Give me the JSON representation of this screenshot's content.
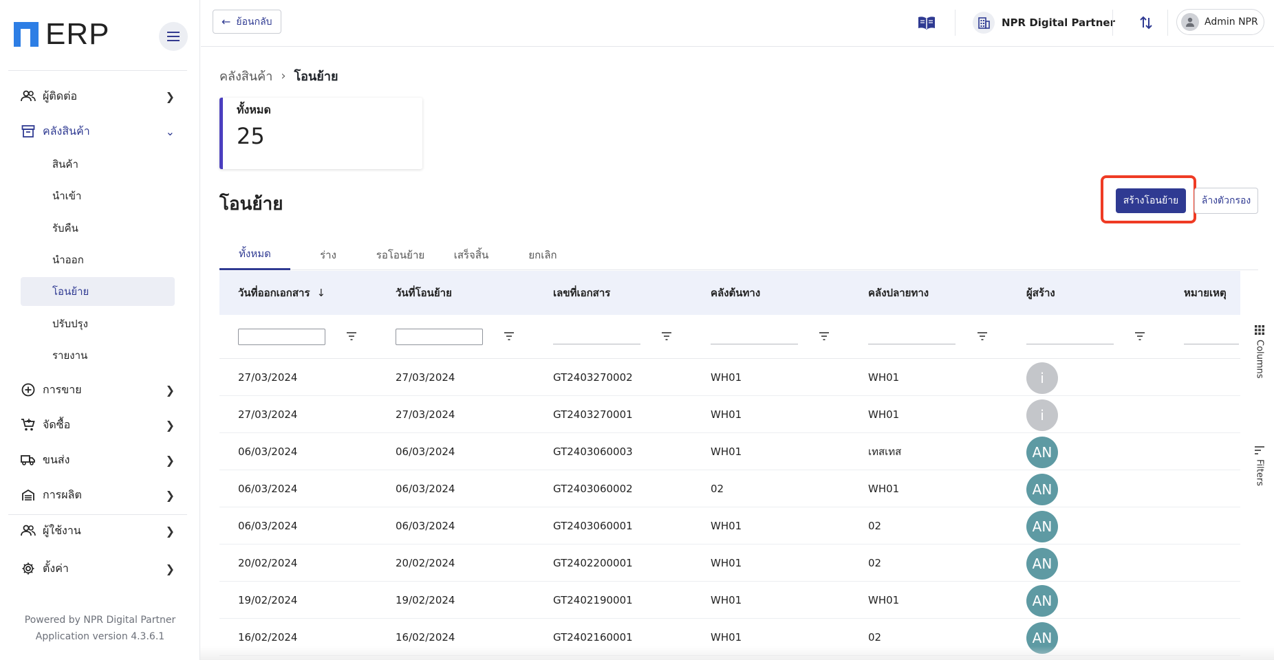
{
  "app": {
    "logo_text": "ERP"
  },
  "sidebar": {
    "items": [
      {
        "label": "ผู้ติดต่อ",
        "icon": "contacts-icon"
      },
      {
        "label": "คลังสินค้า",
        "icon": "warehouse-icon"
      },
      {
        "label": "การขาย",
        "icon": "sales-icon"
      },
      {
        "label": "จัดซื้อ",
        "icon": "purchase-icon"
      },
      {
        "label": "ขนส่ง",
        "icon": "truck-icon"
      },
      {
        "label": "การผลิต",
        "icon": "production-icon"
      },
      {
        "label": "ผู้ใช้งาน",
        "icon": "users-icon"
      },
      {
        "label": "ตั้งค่า",
        "icon": "gear-icon"
      }
    ],
    "sub_items": [
      "สินค้า",
      "นำเข้า",
      "รับคืน",
      "นำออก",
      "โอนย้าย",
      "ปรับปรุง",
      "รายงาน"
    ],
    "footer_line1": "Powered by NPR Digital Partner",
    "footer_line2": "Application version 4.3.6.1"
  },
  "topbar": {
    "back_label": "ย้อนกลับ",
    "company": "NPR Digital Partner",
    "user": "Admin NPR"
  },
  "breadcrumb": {
    "parent": "คลังสินค้า",
    "current": "โอนย้าย"
  },
  "stat": {
    "label": "ทั้งหมด",
    "value": "25"
  },
  "page": {
    "title": "โอนย้าย",
    "create_label": "สร้างโอนย้าย",
    "clear_label": "ล้างตัวกรอง"
  },
  "tabs": [
    "ทั้งหมด",
    "ร่าง",
    "รอโอนย้าย",
    "เสร็จสิ้น",
    "ยกเลิก"
  ],
  "table": {
    "columns": [
      "วันที่ออกเอกสาร",
      "วันที่โอนย้าย",
      "เลขที่เอกสาร",
      "คลังต้นทาง",
      "คลังปลายทาง",
      "ผู้สร้าง",
      "หมายเหตุ"
    ],
    "rows": [
      {
        "issue": "27/03/2024",
        "transfer": "27/03/2024",
        "doc": "GT2403270002",
        "src": "WH01",
        "dst": "WH01",
        "creator": "i"
      },
      {
        "issue": "27/03/2024",
        "transfer": "27/03/2024",
        "doc": "GT2403270001",
        "src": "WH01",
        "dst": "WH01",
        "creator": "i"
      },
      {
        "issue": "06/03/2024",
        "transfer": "06/03/2024",
        "doc": "GT2403060003",
        "src": "WH01",
        "dst": "เทสเทส",
        "creator": "AN"
      },
      {
        "issue": "06/03/2024",
        "transfer": "06/03/2024",
        "doc": "GT2403060002",
        "src": "02",
        "dst": "WH01",
        "creator": "AN"
      },
      {
        "issue": "06/03/2024",
        "transfer": "06/03/2024",
        "doc": "GT2403060001",
        "src": "WH01",
        "dst": "02",
        "creator": "AN"
      },
      {
        "issue": "20/02/2024",
        "transfer": "20/02/2024",
        "doc": "GT2402200001",
        "src": "WH01",
        "dst": "02",
        "creator": "AN"
      },
      {
        "issue": "19/02/2024",
        "transfer": "19/02/2024",
        "doc": "GT2402190001",
        "src": "WH01",
        "dst": "WH01",
        "creator": "AN"
      },
      {
        "issue": "16/02/2024",
        "transfer": "16/02/2024",
        "doc": "GT2402160001",
        "src": "WH01",
        "dst": "02",
        "creator": "AN"
      }
    ]
  },
  "tools": {
    "columns": "Columns",
    "filters": "Filters"
  },
  "colors": {
    "primary": "#2f3a92",
    "highlight": "#ef3b24",
    "avatar_teal": "#5e9aa3"
  }
}
